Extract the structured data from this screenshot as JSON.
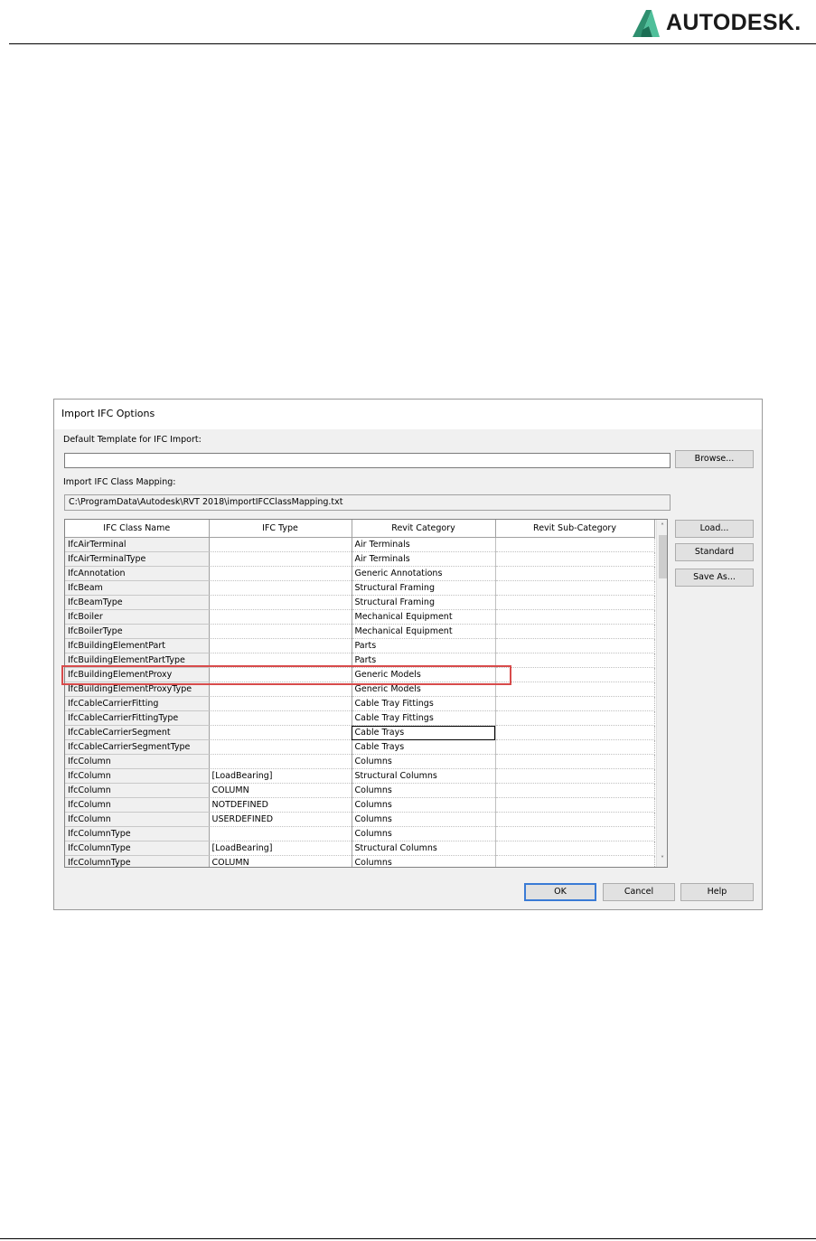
{
  "header": {
    "logo_text": "AUTODESK."
  },
  "dialog": {
    "title": "Import IFC Options",
    "default_template_label": "Default Template for IFC Import:",
    "default_template_value": "",
    "browse_label": "Browse...",
    "mapping_label": "Import IFC Class Mapping:",
    "mapping_path": "C:\\ProgramData\\Autodesk\\RVT 2018\\importIFCClassMapping.txt",
    "side_buttons": {
      "load": "Load...",
      "standard": "Standard",
      "save_as": "Save As..."
    },
    "footer_buttons": {
      "ok": "OK",
      "cancel": "Cancel",
      "help": "Help"
    },
    "columns": [
      "IFC Class Name",
      "IFC Type",
      "Revit Category",
      "Revit Sub-Category"
    ],
    "rows": [
      [
        "IfcAirTerminal",
        "",
        "Air Terminals",
        ""
      ],
      [
        "IfcAirTerminalType",
        "",
        "Air Terminals",
        ""
      ],
      [
        "IfcAnnotation",
        "",
        "Generic Annotations",
        ""
      ],
      [
        "IfcBeam",
        "",
        "Structural Framing",
        ""
      ],
      [
        "IfcBeamType",
        "",
        "Structural Framing",
        ""
      ],
      [
        "IfcBoiler",
        "",
        "Mechanical Equipment",
        ""
      ],
      [
        "IfcBoilerType",
        "",
        "Mechanical Equipment",
        ""
      ],
      [
        "IfcBuildingElementPart",
        "",
        "Parts",
        ""
      ],
      [
        "IfcBuildingElementPartType",
        "",
        "Parts",
        ""
      ],
      [
        "IfcBuildingElementProxy",
        "",
        "Generic Models",
        ""
      ],
      [
        "IfcBuildingElementProxyType",
        "",
        "Generic Models",
        ""
      ],
      [
        "IfcCableCarrierFitting",
        "",
        "Cable Tray Fittings",
        ""
      ],
      [
        "IfcCableCarrierFittingType",
        "",
        "Cable Tray Fittings",
        ""
      ],
      [
        "IfcCableCarrierSegment",
        "",
        "Cable Trays",
        ""
      ],
      [
        "IfcCableCarrierSegmentType",
        "",
        "Cable Trays",
        ""
      ],
      [
        "IfcColumn",
        "",
        "Columns",
        ""
      ],
      [
        "IfcColumn",
        "[LoadBearing]",
        "Structural Columns",
        ""
      ],
      [
        "IfcColumn",
        "COLUMN",
        "Columns",
        ""
      ],
      [
        "IfcColumn",
        "NOTDEFINED",
        "Columns",
        ""
      ],
      [
        "IfcColumn",
        "USERDEFINED",
        "Columns",
        ""
      ],
      [
        "IfcColumnType",
        "",
        "Columns",
        ""
      ],
      [
        "IfcColumnType",
        "[LoadBearing]",
        "Structural Columns",
        ""
      ],
      [
        "IfcColumnType",
        "COLUMN",
        "Columns",
        ""
      ]
    ]
  }
}
